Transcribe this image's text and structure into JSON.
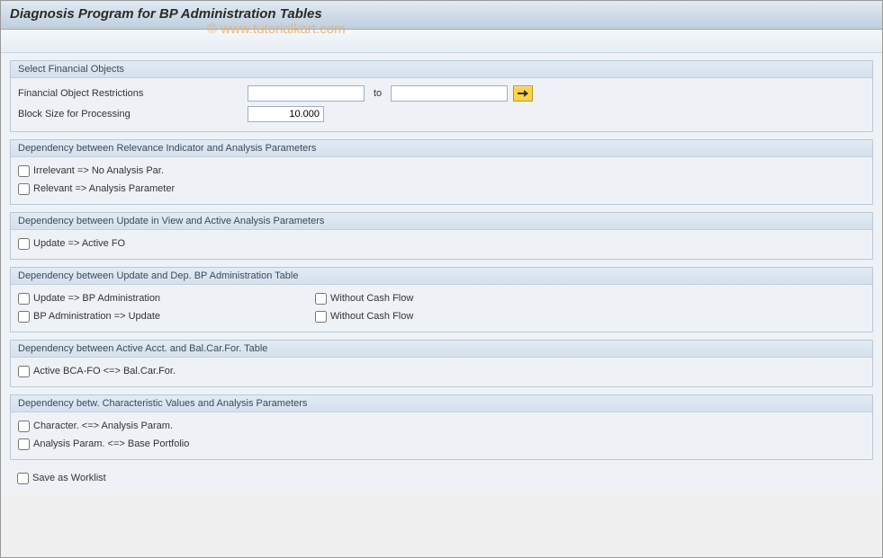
{
  "title": "Diagnosis Program for BP Administration Tables",
  "watermark": "© www.tutorialkart.com",
  "groups": {
    "select_fin": {
      "title": "Select Financial Objects",
      "restrictions_label": "Financial Object Restrictions",
      "to_label": "to",
      "from_value": "",
      "to_value": "",
      "block_label": "Block Size for Processing",
      "block_value": "10.000"
    },
    "dep_relevance": {
      "title": "Dependency between Relevance Indicator and Analysis Parameters",
      "chk1": "Irrelevant => No Analysis Par.",
      "chk2": "Relevant => Analysis Parameter"
    },
    "dep_update_view": {
      "title": "Dependency between Update in View and Active Analysis Parameters",
      "chk1": "Update => Active FO"
    },
    "dep_update_bp": {
      "title": "Dependency between Update and Dep. BP Administration Table",
      "chk1": "Update => BP Administration",
      "chk2": "BP Administration => Update",
      "wcf1": "Without Cash Flow",
      "wcf2": "Without Cash Flow"
    },
    "dep_active_acct": {
      "title": "Dependency between Active Acct. and Bal.Car.For. Table",
      "chk1": "Active BCA-FO <=> Bal.Car.For."
    },
    "dep_char": {
      "title": "Dependency betw. Characteristic Values and Analysis Parameters",
      "chk1": "Character. <=> Analysis Param.",
      "chk2": "Analysis Param. <=> Base Portfolio"
    }
  },
  "save_worklist_label": "Save as Worklist"
}
